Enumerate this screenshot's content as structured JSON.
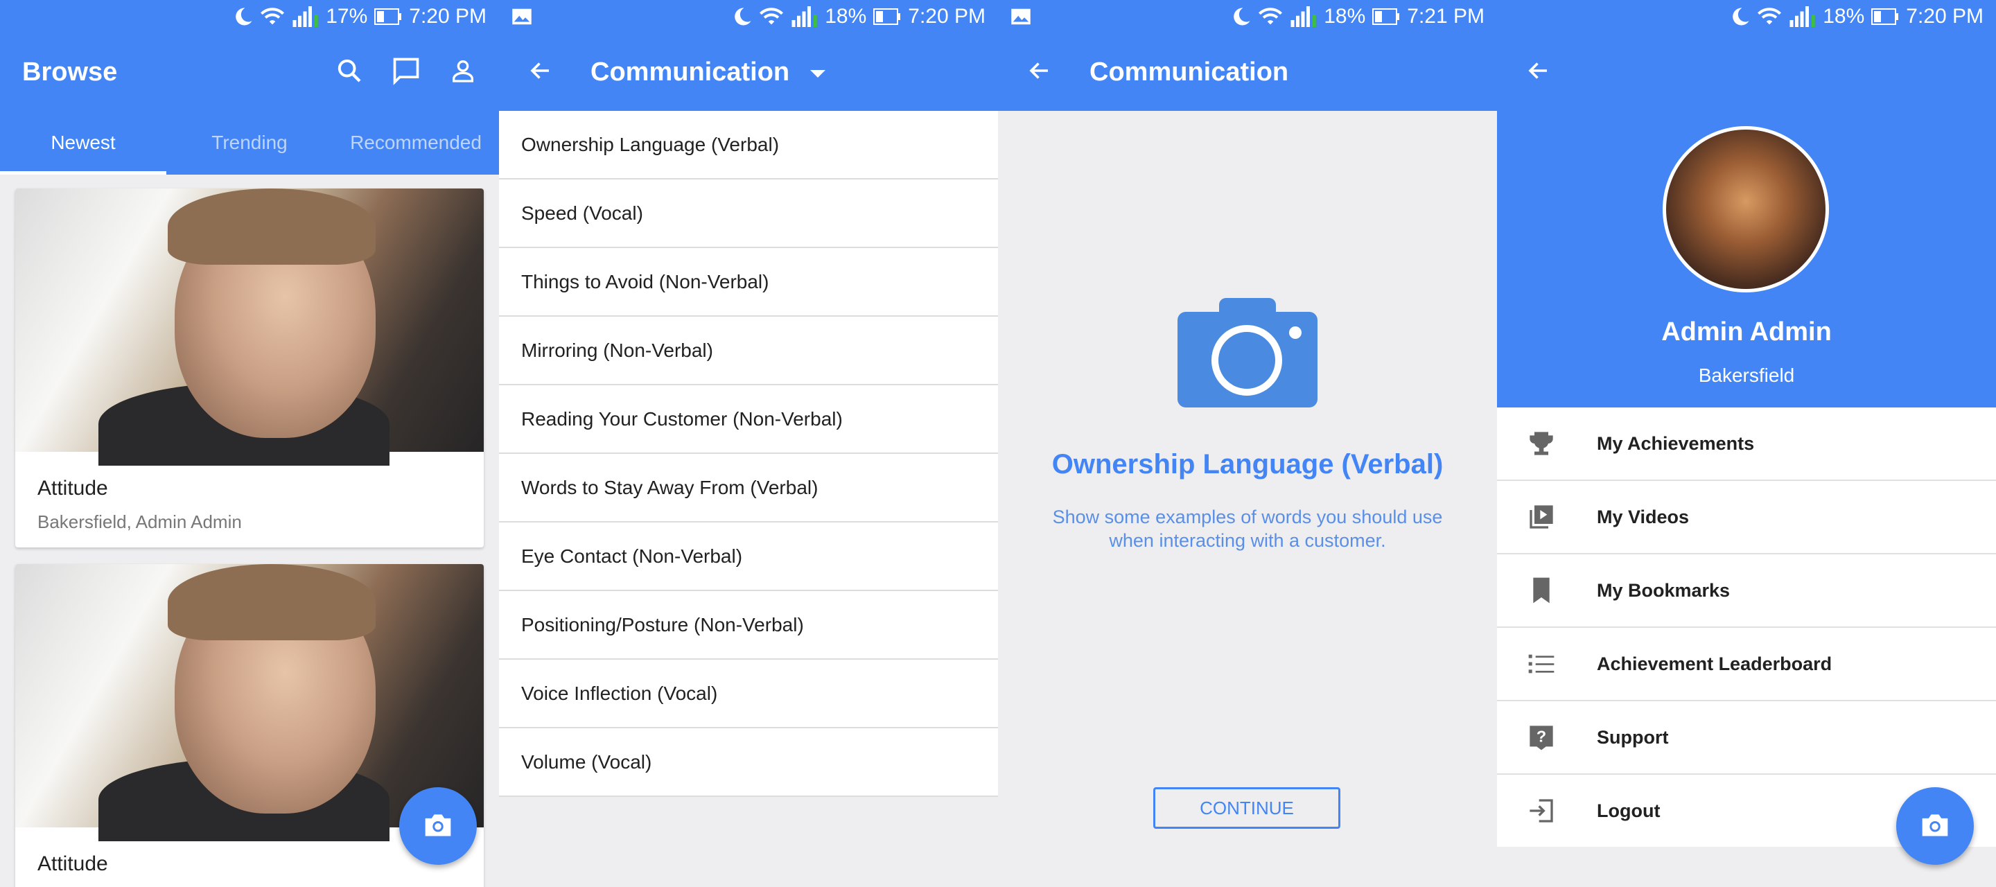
{
  "screen1": {
    "status": {
      "battery": "17%",
      "time": "7:20 PM"
    },
    "title": "Browse",
    "tabs": [
      {
        "label": "Newest",
        "active": true
      },
      {
        "label": "Trending",
        "active": false
      },
      {
        "label": "Recommended",
        "active": false
      }
    ],
    "cards": [
      {
        "title": "Attitude",
        "subtitle": "Bakersfield, Admin Admin"
      },
      {
        "title": "Attitude"
      }
    ],
    "icons": [
      "search-icon",
      "chat-icon",
      "person-icon",
      "camera-icon"
    ]
  },
  "screen2": {
    "status": {
      "battery": "18%",
      "time": "7:20 PM"
    },
    "title": "Communication",
    "items": [
      "Ownership Language (Verbal)",
      "Speed (Vocal)",
      "Things to Avoid (Non-Verbal)",
      "Mirroring (Non-Verbal)",
      "Reading Your Customer (Non-Verbal)",
      "Words to Stay Away From (Verbal)",
      "Eye Contact (Non-Verbal)",
      "Positioning/Posture (Non-Verbal)",
      "Voice Inflection (Vocal)",
      "Volume (Vocal)"
    ]
  },
  "screen3": {
    "status": {
      "battery": "18%",
      "time": "7:21 PM"
    },
    "title": "Communication",
    "headline": "Ownership Language (Verbal)",
    "description": "Show some examples of words you should use when interacting with a customer.",
    "continue_label": "CONTINUE"
  },
  "screen4": {
    "status": {
      "battery": "18%",
      "time": "7:20 PM"
    },
    "name": "Admin Admin",
    "location": "Bakersfield",
    "menu": [
      {
        "label": "My Achievements",
        "icon": "trophy-icon"
      },
      {
        "label": "My Videos",
        "icon": "video-library-icon"
      },
      {
        "label": "My Bookmarks",
        "icon": "bookmark-icon"
      },
      {
        "label": "Achievement Leaderboard",
        "icon": "list-icon"
      },
      {
        "label": "Support",
        "icon": "help-icon"
      },
      {
        "label": "Logout",
        "icon": "logout-icon"
      }
    ]
  },
  "colors": {
    "primary": "#4385f4",
    "background": "#eeeef0",
    "divider": "#dcdcdc"
  }
}
